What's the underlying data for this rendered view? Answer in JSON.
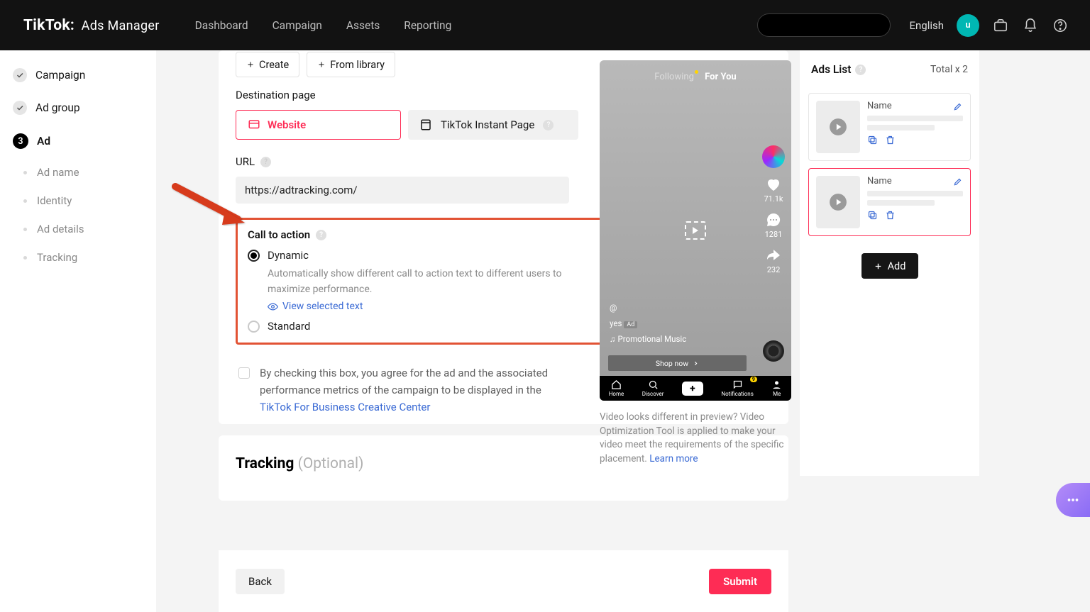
{
  "topnav": {
    "brand_main": "TikTok",
    "brand_sep": ":",
    "brand_sub": "Ads Manager",
    "links": [
      "Dashboard",
      "Campaign",
      "Assets",
      "Reporting"
    ],
    "language": "English",
    "avatar_initial": "u"
  },
  "sidebar": {
    "steps": [
      {
        "label": "Campaign",
        "done": true
      },
      {
        "label": "Ad group",
        "done": true
      },
      {
        "label": "Ad",
        "num": "3"
      }
    ],
    "subs": [
      "Ad name",
      "Identity",
      "Ad details",
      "Tracking"
    ]
  },
  "buttons": {
    "create": "Create",
    "from_library": "From library",
    "back": "Back",
    "submit": "Submit",
    "add": "Add"
  },
  "form": {
    "destination_label": "Destination page",
    "website_label": "Website",
    "instant_label": "TikTok Instant Page",
    "url_label": "URL",
    "url_value": "https://adtracking.com/",
    "cta_label": "Call to action",
    "cta_dynamic": "Dynamic",
    "cta_dynamic_desc": "Automatically show different call to action text to different users to maximize performance.",
    "cta_view_selected": "View selected text",
    "cta_standard": "Standard",
    "agree_text_part1": "By checking this box, you agree for the ad and the associated performance metrics of the campaign to be displayed in the  ",
    "agree_link": "TikTok For Business Creative Center",
    "tracking_title": "Tracking",
    "tracking_optional": "(Optional)"
  },
  "preview": {
    "following": "Following",
    "foryou": "For You",
    "likes": "71.1k",
    "comments": "1281",
    "shares": "232",
    "handle": "@",
    "caption": "yes",
    "music_prefix": "♫",
    "music": "Promotional Music",
    "cta_button": "Shop now",
    "bottom": {
      "home": "Home",
      "discover": "Discover",
      "notifications": "Notifications",
      "me": "Me",
      "notif_badge": "9"
    },
    "note_text": "Video looks different in preview? Video Optimization Tool is applied to make your video meet the requirements of the specific placement. ",
    "note_link": "Learn more"
  },
  "adslist": {
    "title": "Ads List",
    "total_label": "Total x 2",
    "name_label": "Name"
  }
}
